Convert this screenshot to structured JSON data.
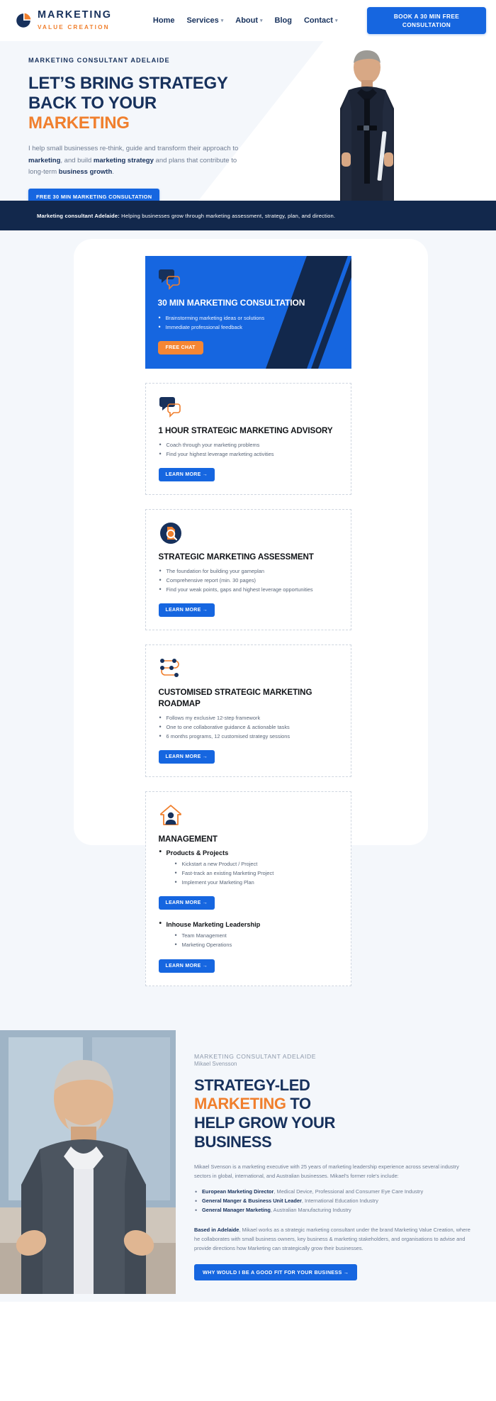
{
  "header": {
    "logo": {
      "top": "MARKETING",
      "sub": "VALUE CREATION"
    },
    "nav": [
      {
        "label": "Home",
        "caret": false
      },
      {
        "label": "Services",
        "caret": true
      },
      {
        "label": "About",
        "caret": true
      },
      {
        "label": "Blog",
        "caret": false
      },
      {
        "label": "Contact",
        "caret": true
      }
    ],
    "cta": "BOOK A 30 MIN FREE CONSULTATION"
  },
  "hero": {
    "eyebrow": "MARKETING CONSULTANT ADELAIDE",
    "line1": "LET’S BRING STRATEGY",
    "line2": "BACK TO YOUR",
    "line3": "MARKETING",
    "paragraph_pre": "I help small businesses re-think, guide and transform their approach to ",
    "paragraph_b1": "marketing",
    "paragraph_mid1": ", and build ",
    "paragraph_b2": "marketing strategy",
    "paragraph_mid2": " and plans that contribute to long-term ",
    "paragraph_b3": "business growth",
    "paragraph_end": ".",
    "cta": "FREE 30 MIN MARKETING CONSULTATION"
  },
  "strip": {
    "bold": "Marketing consultant Adelaide:",
    "rest": " Helping businesses grow through marketing assessment, strategy, plan, and direction."
  },
  "services": [
    {
      "id": "consultation",
      "style": "blue",
      "icon": "speech-bubbles-icon",
      "title": "30 MIN MARKETING CONSULTATION",
      "bullets": [
        "Brainstorming marketing ideas or solutions",
        "Immediate professional feedback"
      ],
      "button": "FREE CHAT"
    },
    {
      "id": "advisory",
      "style": "white",
      "icon": "speech-bubbles-icon",
      "title": "1 HOUR STRATEGIC MARKETING ADVISORY",
      "bullets": [
        "Coach through your marketing problems",
        "Find your highest leverage marketing activities"
      ],
      "button": "LEARN MORE →"
    },
    {
      "id": "assessment",
      "style": "white",
      "icon": "document-search-icon",
      "title": "STRATEGIC MARKETING ASSESSMENT",
      "bullets": [
        "The foundation for building your gameplan",
        "Comprehensive report (min. 30 pages)",
        "Find your weak points, gaps and highest leverage opportunities"
      ],
      "button": "LEARN MORE →"
    },
    {
      "id": "roadmap",
      "style": "white",
      "icon": "roadmap-nodes-icon",
      "title": "CUSTOMISED STRATEGIC MARKETING ROADMAP",
      "bullets": [
        "Follows my exclusive 12-step framework",
        "One to one collaborative guidance & actionable tasks",
        "6 months programs, 12 customised strategy sessions"
      ],
      "button": "LEARN MORE →"
    }
  ],
  "management": {
    "icon": "person-house-icon",
    "title": "MANAGEMENT",
    "groups": [
      {
        "heading": "Products & Projects",
        "bullets": [
          "Kickstart a new Product / Project",
          "Fast-track an existing Marketing Project",
          "Implement your Marketing Plan"
        ],
        "button": "LEARN MORE →"
      },
      {
        "heading": "Inhouse Marketing Leadership",
        "bullets": [
          "Team Management",
          "Marketing Operations"
        ],
        "button": "LEARN MORE →"
      }
    ]
  },
  "bio": {
    "eyebrow": "MARKETING CONSULTANT ADELAIDE",
    "name": "Mikael Svensson",
    "h2_line1": "STRATEGY-LED",
    "h2_accent": "MARKETING",
    "h2_after_accent": " TO",
    "h2_line3": "HELP GROW YOUR",
    "h2_line4": "BUSINESS",
    "p1": "Mikael Svenson is a marketing executive with 25 years of marketing leadership experience across several industry sectors in global, international, and Australian businesses.  Mikael's former role's include:",
    "roles": [
      {
        "bold": "European Marketing Director",
        "rest": ", Medical Device, Professional and Consumer Eye Care Industry"
      },
      {
        "bold": "General Manger & Business Unit Leader",
        "rest": ", International Education Industry"
      },
      {
        "bold": "General Manager Marketing",
        "rest": ", Australian Manufacturing Industry"
      }
    ],
    "p2_bold": "Based in Adelaide",
    "p2_rest": ", Mikael works as a strategic marketing consultant under the brand Marketing Value Creation, where he collaborates with small business owners, key business & marketing stakeholders, and organisations to advise and provide directions how Marketing can strategically grow their businesses.",
    "cta": "WHY WOULD I BE A GOOD FIT FOR YOUR BUSINESS →"
  },
  "colors": {
    "navy": "#17315c",
    "deep_navy": "#12284c",
    "blue": "#1666e0",
    "orange": "#f07f2d",
    "orange_btn": "#f58634",
    "page_bg": "#f4f7fb"
  }
}
